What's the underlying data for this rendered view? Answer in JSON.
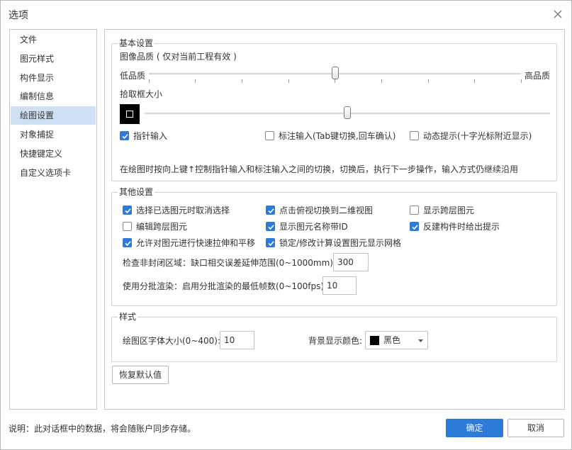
{
  "window": {
    "title": "选项"
  },
  "sidebar": {
    "items": [
      {
        "label": "文件"
      },
      {
        "label": "图元样式"
      },
      {
        "label": "构件显示"
      },
      {
        "label": "编制信息"
      },
      {
        "label": "绘图设置",
        "active": true
      },
      {
        "label": "对象捕捉"
      },
      {
        "label": "快捷键定义"
      },
      {
        "label": "自定义选项卡"
      }
    ]
  },
  "basic": {
    "title": "基本设置",
    "image_quality_label": "图像品质 ( 仅对当前工程有效 )",
    "low_label": "低品质",
    "high_label": "高品质",
    "image_quality_level": 0.5,
    "pick_box_label": "拾取框大小",
    "pick_box_level": 0.5,
    "pointer_input": {
      "label": "指针输入",
      "checked": true
    },
    "dimension_input": {
      "label": "标注输入(Tab键切换,回车确认)",
      "checked": false
    },
    "dynamic_prompt": {
      "label": "动态提示(十字光标附近显示)",
      "checked": false
    },
    "hint": "在绘图时按向上键↑控制指针输入和标注输入之间的切换，切换后，执行下一步操作，输入方式仍继续沿用"
  },
  "other": {
    "title": "其他设置",
    "options": [
      {
        "label": "选择已选图元时取消选择",
        "checked": true
      },
      {
        "label": "点击俯视切换到二维视图",
        "checked": true
      },
      {
        "label": "显示跨层图元",
        "checked": false
      },
      {
        "label": "编辑跨层图元",
        "checked": false
      },
      {
        "label": "显示图元名称带ID",
        "checked": true
      },
      {
        "label": "反建构件时给出提示",
        "checked": true
      },
      {
        "label": "允许对图元进行快速拉伸和平移",
        "checked": true
      },
      {
        "label": "锁定/修改计算设置图元显示网格",
        "checked": true
      }
    ],
    "gap_label": "检查非封闭区域：缺口相交误差延伸范围(0~1000mm):",
    "gap_value": "300",
    "batch_label": "使用分批渲染：启用分批渲染的最低帧数(0~100fps):",
    "batch_value": "10"
  },
  "style": {
    "title": "样式",
    "font_size_label": "绘图区字体大小(0~400):",
    "font_size_value": "10",
    "bg_color_label": "背景显示颜色:",
    "bg_color_value": "黑色",
    "bg_color_swatch": "#000000"
  },
  "restore_label": "恢复默认值",
  "footer": {
    "note": "说明：此对话框中的数据，将会随账户同步存储。",
    "ok_label": "确定",
    "cancel_label": "取消"
  },
  "colors": {
    "accent": "#2d7ad9",
    "sidebar_active": "#cfe0f4"
  }
}
